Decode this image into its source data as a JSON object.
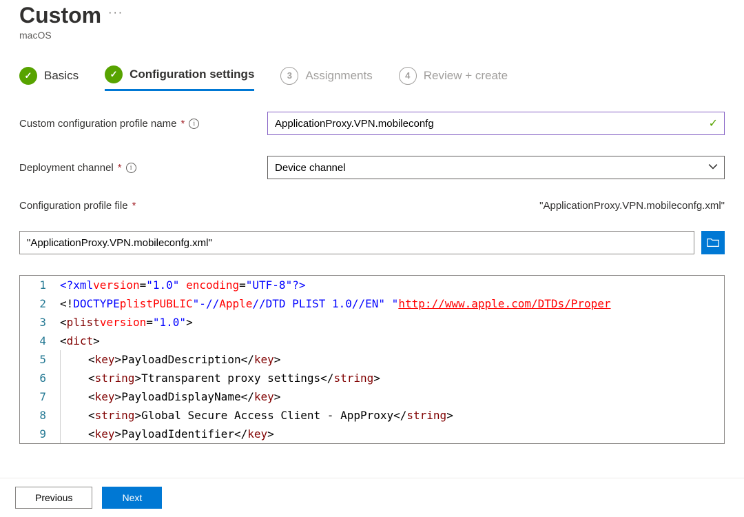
{
  "header": {
    "title": "Custom",
    "subtitle": "macOS"
  },
  "steps": [
    {
      "label": "Basics",
      "status": "done"
    },
    {
      "label": "Configuration settings",
      "status": "active"
    },
    {
      "label": "Assignments",
      "status": "pending",
      "num": "3"
    },
    {
      "label": "Review + create",
      "status": "pending",
      "num": "4"
    }
  ],
  "fields": {
    "profile_name": {
      "label": "Custom configuration profile name",
      "value": "ApplicationProxy.VPN.mobileconfg"
    },
    "deployment_channel": {
      "label": "Deployment channel",
      "value": "Device channel"
    },
    "config_file": {
      "label": "Configuration profile file",
      "display": "\"ApplicationProxy.VPN.mobileconfg.xml\"",
      "input_value": "\"ApplicationProxy.VPN.mobileconfg.xml\""
    }
  },
  "code": {
    "lines": [
      {
        "n": "1",
        "t": "xml-decl"
      },
      {
        "n": "2",
        "t": "doctype"
      },
      {
        "n": "3",
        "t": "plist-open"
      },
      {
        "n": "4",
        "t": "dict-open"
      },
      {
        "n": "5",
        "t": "key",
        "k": "PayloadDescription"
      },
      {
        "n": "6",
        "t": "string",
        "v": "Ttransparent proxy settings"
      },
      {
        "n": "7",
        "t": "key",
        "k": "PayloadDisplayName"
      },
      {
        "n": "8",
        "t": "string",
        "v": "Global Secure Access Client - AppProxy"
      },
      {
        "n": "9",
        "t": "key",
        "k": "PayloadIdentifier"
      }
    ],
    "doctype_parts": {
      "doctype": "DOCTYPE",
      "plist": "plist",
      "public": "PUBLIC",
      "fpi_pre": "\"-//",
      "fpi_apple": "Apple",
      "fpi_mid": "//DTD PLIST 1.0//",
      "fpi_en": "EN",
      "fpi_post": "\" \"",
      "url": "http://www.apple.com/DTDs/Proper"
    },
    "xml_decl": {
      "version_attr": "version",
      "version_val": "\"1.0\"",
      "encoding_attr": "encoding",
      "encoding_val": "\"UTF-8\""
    },
    "plist_attr": {
      "version_attr": "version",
      "version_val": "\"1.0\""
    }
  },
  "footer": {
    "previous": "Previous",
    "next": "Next"
  },
  "glyphs": {
    "check": "✓",
    "info": "i",
    "dots": "···"
  }
}
